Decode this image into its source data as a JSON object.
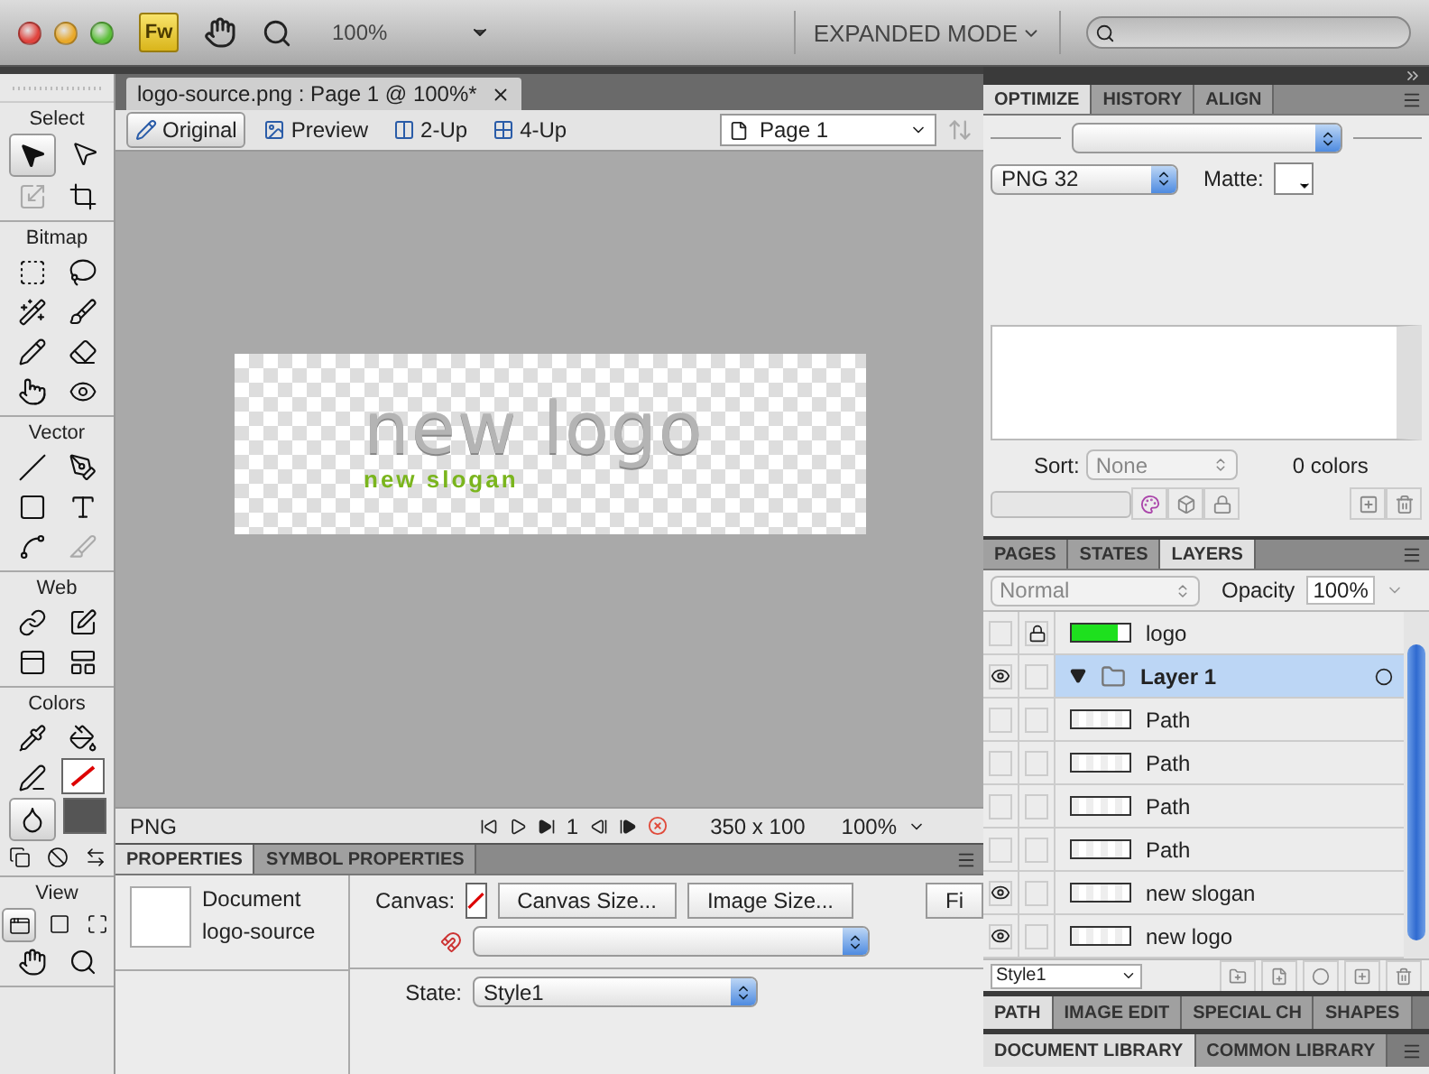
{
  "app_bar": {
    "logo": "Fw",
    "zoom": "100%",
    "mode": "EXPANDED MODE"
  },
  "tools": [
    {
      "title": "Select",
      "rows": [
        [
          {
            "kind": "pointer",
            "selected": true,
            "disabled": false
          },
          {
            "kind": "subselect",
            "selected": false,
            "disabled": false
          }
        ],
        [
          {
            "kind": "scale",
            "selected": false,
            "disabled": true
          },
          {
            "kind": "crop",
            "selected": false,
            "disabled": false
          }
        ]
      ]
    },
    {
      "title": "Bitmap",
      "rows": [
        [
          {
            "kind": "marquee",
            "selected": false,
            "disabled": false
          },
          {
            "kind": "lasso",
            "selected": false,
            "disabled": false
          }
        ],
        [
          {
            "kind": "wand",
            "selected": false,
            "disabled": false
          },
          {
            "kind": "brush",
            "selected": false,
            "disabled": false
          }
        ],
        [
          {
            "kind": "pencil",
            "selected": false,
            "disabled": false
          },
          {
            "kind": "eraser",
            "selected": false,
            "disabled": false
          }
        ],
        [
          {
            "kind": "blur",
            "selected": false,
            "disabled": false
          },
          {
            "kind": "redeye",
            "selected": false,
            "disabled": false
          }
        ]
      ]
    },
    {
      "title": "Vector",
      "rows": [
        [
          {
            "kind": "line",
            "selected": false,
            "disabled": false
          },
          {
            "kind": "pen",
            "selected": false,
            "disabled": false
          }
        ],
        [
          {
            "kind": "rectangle",
            "selected": false,
            "disabled": false
          },
          {
            "kind": "text",
            "selected": false,
            "disabled": false
          }
        ],
        [
          {
            "kind": "freeform",
            "selected": false,
            "disabled": false
          },
          {
            "kind": "knife",
            "selected": false,
            "disabled": true
          }
        ]
      ]
    },
    {
      "title": "Web",
      "rows": [
        [
          {
            "kind": "hotspot",
            "selected": false,
            "disabled": false
          },
          {
            "kind": "slice",
            "selected": false,
            "disabled": false
          }
        ],
        [
          {
            "kind": "hide-slices",
            "selected": false,
            "disabled": false
          },
          {
            "kind": "show-slices",
            "selected": false,
            "disabled": false
          }
        ]
      ]
    },
    {
      "title": "Colors",
      "rows": [
        [
          {
            "kind": "eyedropper",
            "selected": false,
            "disabled": false
          },
          {
            "kind": "bucket",
            "selected": false,
            "disabled": false
          }
        ],
        [
          {
            "kind": "stroke",
            "selected": false,
            "disabled": false
          },
          {
            "kind": "stroke-swatch",
            "selected": false,
            "disabled": false
          }
        ],
        [
          {
            "kind": "fill",
            "selected": true,
            "disabled": false
          },
          {
            "kind": "fill-swatch",
            "selected": false,
            "disabled": false
          }
        ],
        [
          {
            "kind": "default-colors",
            "selected": false,
            "disabled": false
          },
          {
            "kind": "no-color",
            "selected": false,
            "disabled": false
          },
          {
            "kind": "swap",
            "selected": false,
            "disabled": false
          }
        ]
      ]
    },
    {
      "title": "View",
      "rows": [
        [
          {
            "kind": "standard-mode",
            "selected": true,
            "disabled": false
          },
          {
            "kind": "menu-mode",
            "selected": false,
            "disabled": false
          },
          {
            "kind": "full-mode",
            "selected": false,
            "disabled": false
          }
        ],
        [
          {
            "kind": "hand",
            "selected": false,
            "disabled": false
          },
          {
            "kind": "zoom",
            "selected": false,
            "disabled": false
          }
        ]
      ]
    }
  ],
  "document": {
    "tab_title": "logo-source.png : Page 1 @ 100%*",
    "views": [
      {
        "label": "Original",
        "selected": true
      },
      {
        "label": "Preview",
        "selected": false
      },
      {
        "label": "2-Up",
        "selected": false
      },
      {
        "label": "4-Up",
        "selected": false
      }
    ],
    "page": "Page 1",
    "artwork": {
      "title": "new logo",
      "slogan": "new slogan"
    },
    "status": {
      "format": "PNG",
      "frame": "1",
      "size": "350 x 100",
      "zoom": "100%"
    }
  },
  "properties": {
    "tabs": [
      {
        "label": "PROPERTIES",
        "selected": true
      },
      {
        "label": "SYMBOL PROPERTIES",
        "selected": false
      }
    ],
    "doc_type": "Document",
    "doc_name": "logo-source",
    "canvas_label": "Canvas:",
    "buttons": [
      "Canvas Size...",
      "Image Size...",
      "Fi"
    ],
    "state_label": "State:",
    "state_value": "Style1"
  },
  "optimize": {
    "tabs": [
      {
        "label": "OPTIMIZE",
        "selected": true
      },
      {
        "label": "HISTORY",
        "selected": false
      },
      {
        "label": "ALIGN",
        "selected": false
      }
    ],
    "format": "PNG 32",
    "matte_label": "Matte:",
    "sort_label": "Sort:",
    "sort_value": "None",
    "colors": "0 colors"
  },
  "layers": {
    "tabs": [
      {
        "label": "PAGES",
        "selected": false
      },
      {
        "label": "STATES",
        "selected": false
      },
      {
        "label": "LAYERS",
        "selected": true
      }
    ],
    "blend": "Normal",
    "opacity_label": "Opacity",
    "opacity": "100%",
    "rows": [
      {
        "name": "logo",
        "kind": "swatch",
        "visible": false,
        "locked": true,
        "selected": false
      },
      {
        "name": "Layer 1",
        "kind": "folder",
        "visible": true,
        "locked": false,
        "selected": true,
        "expanded": true
      },
      {
        "name": "Path",
        "kind": "object",
        "visible": false,
        "locked": false,
        "selected": false
      },
      {
        "name": "Path",
        "kind": "object",
        "visible": false,
        "locked": false,
        "selected": false
      },
      {
        "name": "Path",
        "kind": "object",
        "visible": false,
        "locked": false,
        "selected": false
      },
      {
        "name": "Path",
        "kind": "object",
        "visible": false,
        "locked": false,
        "selected": false
      },
      {
        "name": "new slogan",
        "kind": "object",
        "visible": true,
        "locked": false,
        "selected": false
      },
      {
        "name": "new logo",
        "kind": "object",
        "visible": true,
        "locked": false,
        "selected": false
      }
    ],
    "style": "Style1"
  },
  "panel_tabs": [
    {
      "label": "PATH",
      "selected": true
    },
    {
      "label": "IMAGE EDIT",
      "selected": false
    },
    {
      "label": "SPECIAL CH",
      "selected": false
    },
    {
      "label": "SHAPES",
      "selected": false
    }
  ],
  "library_tabs": [
    {
      "label": "DOCUMENT LIBRARY",
      "selected": true
    },
    {
      "label": "COMMON LIBRARY",
      "selected": false
    }
  ]
}
